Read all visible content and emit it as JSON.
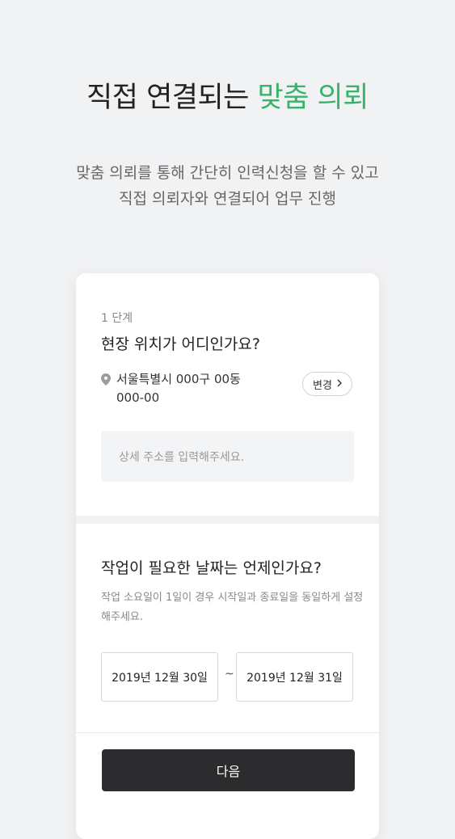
{
  "header": {
    "headline_plain": "직접 연결되는 ",
    "headline_accent": "맞춤 의뢰",
    "subtitle_line1": "맞춤 의뢰를 통해 간단히 인력신청을 할 수 있고",
    "subtitle_line2": "직접 의뢰자와 연결되어 업무 진행"
  },
  "form": {
    "step_label": "1 단계",
    "location_question": "현장 위치가 어디인가요?",
    "address_line1": "서울특별시 000구 00동",
    "address_line2": "000-00",
    "change_button_label": "변경",
    "detail_placeholder": "상세 주소를 입력해주세요.",
    "date_question": "작업이 필요한 날짜는 언제인가요?",
    "date_hint": "작업 소요일이 1일이 경우 시작일과 종료일을 동일하게 설정해주세요.",
    "start_date": "2019년 12월 30일",
    "range_separator": "~",
    "end_date": "2019년 12월 31일",
    "next_button_label": "다음"
  },
  "icons": {
    "location": "location-pin-icon",
    "chevron": "chevron-right-icon"
  },
  "colors": {
    "accent": "#3ab26a",
    "button_dark": "#2c2c2e",
    "background": "#f1f2f4"
  }
}
